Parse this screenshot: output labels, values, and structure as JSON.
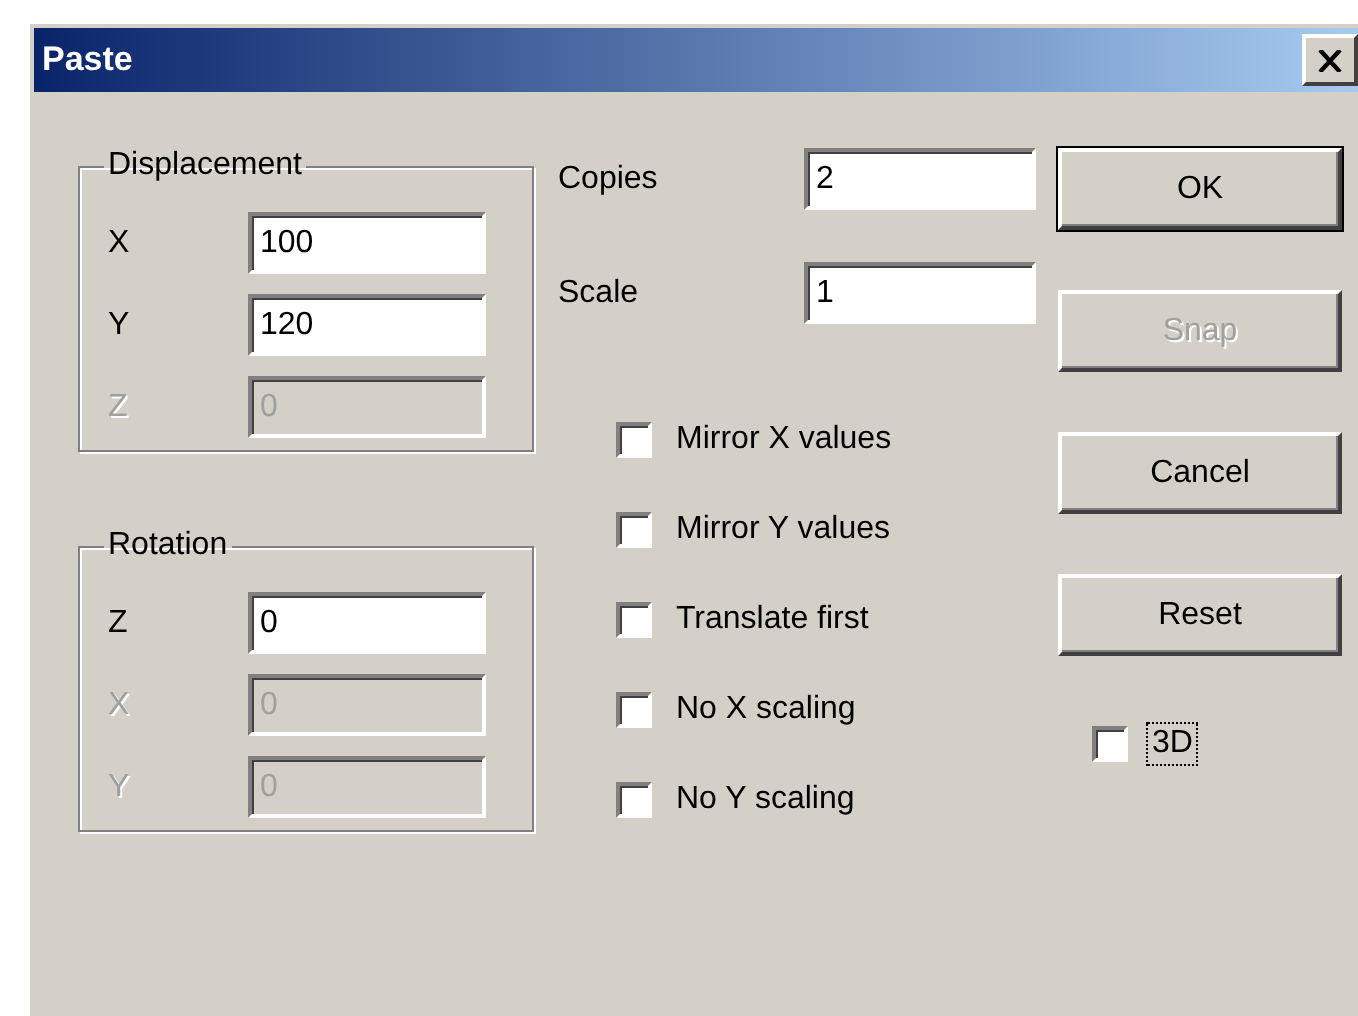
{
  "window": {
    "title": "Paste"
  },
  "displacement": {
    "label": "Displacement",
    "rows": [
      {
        "label": "X",
        "value": "100",
        "disabled": false
      },
      {
        "label": "Y",
        "value": "120",
        "disabled": false
      },
      {
        "label": "Z",
        "value": "0",
        "disabled": true
      }
    ]
  },
  "copies": {
    "label": "Copies",
    "value": "2"
  },
  "scale": {
    "label": "Scale",
    "value": "1"
  },
  "rotation": {
    "label": "Rotation",
    "rows": [
      {
        "label": "Z",
        "value": "0",
        "disabled": false
      },
      {
        "label": "X",
        "value": "0",
        "disabled": true
      },
      {
        "label": "Y",
        "value": "0",
        "disabled": true
      }
    ]
  },
  "checkboxes": [
    {
      "label": "Mirror X values",
      "checked": false
    },
    {
      "label": "Mirror Y values",
      "checked": false
    },
    {
      "label": "Translate first",
      "checked": false
    },
    {
      "label": "No X scaling",
      "checked": false
    },
    {
      "label": "No Y scaling",
      "checked": false
    }
  ],
  "buttons": [
    {
      "label": "OK",
      "disabled": false,
      "default": true
    },
    {
      "label": "Snap",
      "disabled": true,
      "default": false
    },
    {
      "label": "Cancel",
      "disabled": false,
      "default": false
    },
    {
      "label": "Reset",
      "disabled": false,
      "default": false
    }
  ],
  "option_3d": {
    "label": "3D",
    "checked": false,
    "focused": true
  }
}
